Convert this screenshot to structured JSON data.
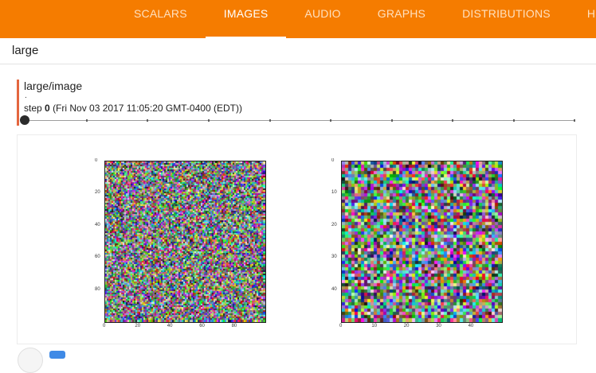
{
  "header": {
    "tabs": [
      {
        "label": "SCALARS",
        "active": false
      },
      {
        "label": "IMAGES",
        "active": true
      },
      {
        "label": "AUDIO",
        "active": false
      },
      {
        "label": "GRAPHS",
        "active": false
      },
      {
        "label": "DISTRIBUTIONS",
        "active": false
      },
      {
        "label": "HISTOGRAMS",
        "active": false
      }
    ],
    "accent_color": "#f57c00"
  },
  "group": {
    "title": "large"
  },
  "card": {
    "tag": "large/image",
    "dot": ".",
    "step_label": "step",
    "step_value": "0",
    "timestamp": "(Fri Nov 03 2017 11:05:20 GMT-0400 (EDT))",
    "step_position": 0
  },
  "images": [
    {
      "x_ticks": [
        "0",
        "20",
        "40",
        "60",
        "80"
      ],
      "y_ticks": [
        "0",
        "20",
        "40",
        "60",
        "80"
      ]
    },
    {
      "x_ticks": [
        "0",
        "10",
        "20",
        "30",
        "40"
      ],
      "y_ticks": [
        "0",
        "10",
        "20",
        "30",
        "40"
      ]
    }
  ]
}
